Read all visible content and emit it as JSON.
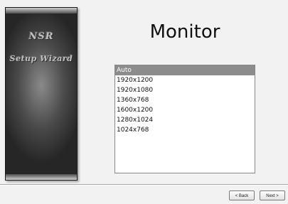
{
  "sidebar": {
    "brand": "NSR",
    "subtitle": "Setup Wizard"
  },
  "page": {
    "title": "Monitor"
  },
  "resolutions": {
    "selected": "Auto",
    "items": [
      "Auto",
      "1920x1200",
      "1920x1080",
      "1360x768",
      "1600x1200",
      "1280x1024",
      "1024x768"
    ]
  },
  "buttons": {
    "back": "< Back",
    "next": "Next >"
  }
}
